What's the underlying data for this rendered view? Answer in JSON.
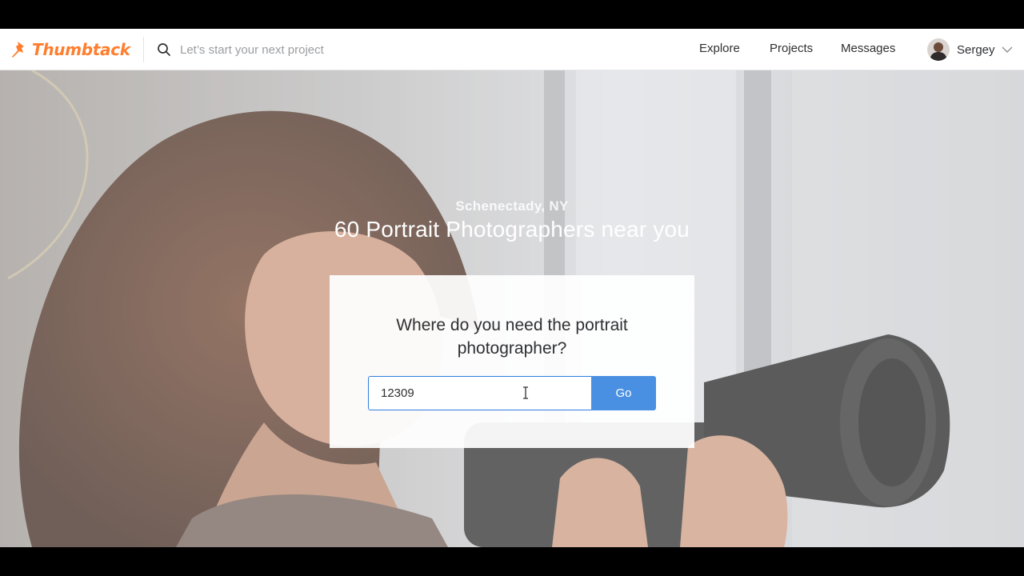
{
  "navbar": {
    "logo_text": "Thumbtack",
    "search_placeholder": "Let’s start your next project",
    "links": {
      "explore": "Explore",
      "projects": "Projects",
      "messages": "Messages"
    },
    "user_name": "Sergey"
  },
  "hero": {
    "location": "Schenectady, NY",
    "title": "60 Portrait Photographers near you"
  },
  "zip_card": {
    "question": "Where do you need the portrait photographer?",
    "zip_value": "12309",
    "go_label": "Go"
  },
  "colors": {
    "brand": "#ff7e2e",
    "accent": "#4a90e2",
    "text": "#2f3033"
  },
  "icons": {
    "logo": "pushpin-icon",
    "search": "search-icon",
    "user_menu": "chevron-down-icon"
  }
}
